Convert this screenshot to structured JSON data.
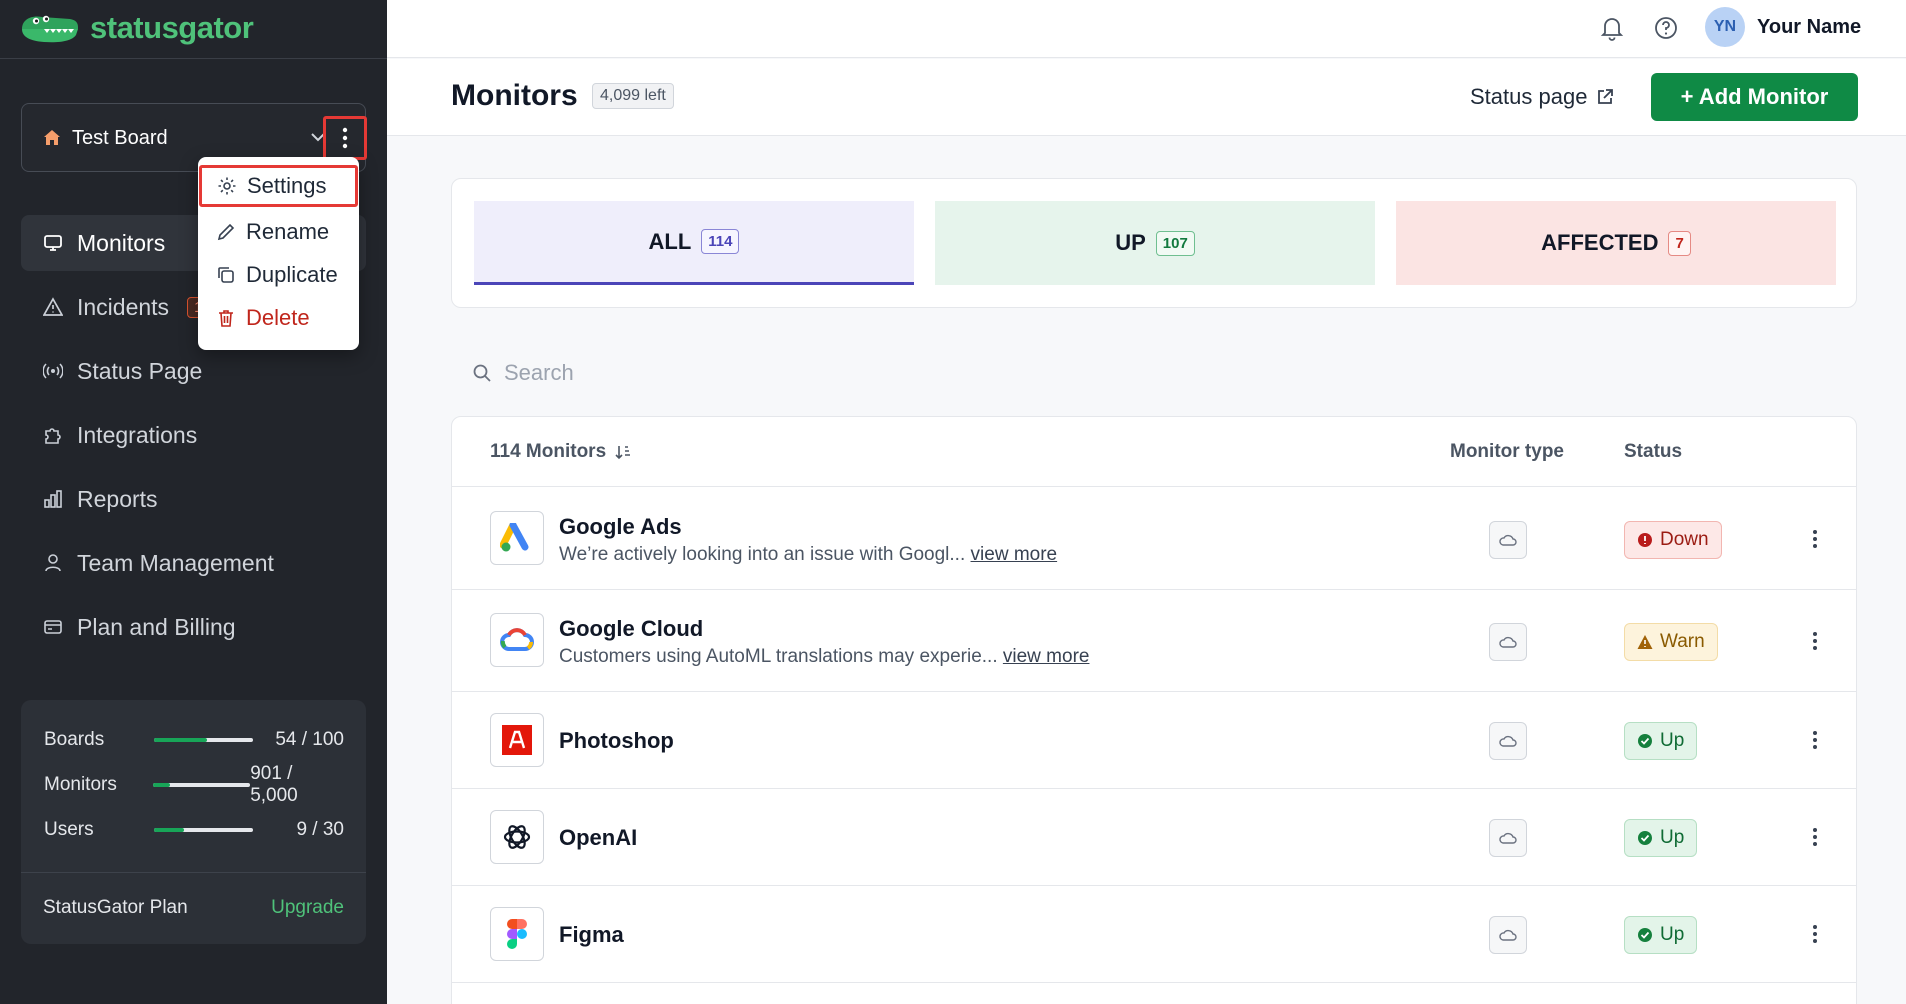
{
  "app": {
    "brand": "statusgator",
    "colors": {
      "sidebar": "#22252b",
      "accent_green": "#0f8a45",
      "brand_green": "#4fc27a",
      "highlight_red": "#e53935"
    }
  },
  "sidebar": {
    "board": {
      "name": "Test Board",
      "icon": "home-icon"
    },
    "board_menu": {
      "items": [
        {
          "label": "Settings",
          "icon": "gear-icon",
          "selected": true
        },
        {
          "label": "Rename",
          "icon": "pencil-icon"
        },
        {
          "label": "Duplicate",
          "icon": "copy-icon"
        },
        {
          "label": "Delete",
          "icon": "trash-icon",
          "danger": true
        }
      ]
    },
    "nav": [
      {
        "label": "Monitors",
        "icon": "monitor-icon",
        "active": true
      },
      {
        "label": "Incidents",
        "icon": "warning-icon",
        "badge": "1"
      },
      {
        "label": "Status Page",
        "icon": "broadcast-icon"
      },
      {
        "label": "Integrations",
        "icon": "puzzle-icon"
      },
      {
        "label": "Reports",
        "icon": "bar-chart-icon"
      },
      {
        "label": "Team Management",
        "icon": "user-icon"
      },
      {
        "label": "Plan and Billing",
        "icon": "credit-card-icon"
      }
    ],
    "usage": [
      {
        "label": "Boards",
        "value": "54 / 100",
        "fraction": 0.54
      },
      {
        "label": "Monitors",
        "value": "901 / 5,000",
        "fraction": 0.18
      },
      {
        "label": "Users",
        "value": "9 / 30",
        "fraction": 0.3
      }
    ],
    "plan": {
      "name": "StatusGator Plan",
      "upgrade_label": "Upgrade"
    }
  },
  "topbar": {
    "user_initials": "YN",
    "user_name": "Your Name",
    "icons": [
      "bell-icon",
      "help-icon"
    ]
  },
  "header": {
    "title": "Monitors",
    "left_badge": "4,099 left",
    "status_page_label": "Status page",
    "add_button_label": "+ Add Monitor"
  },
  "filters": [
    {
      "label": "ALL",
      "count": "114",
      "active": true
    },
    {
      "label": "UP",
      "count": "107"
    },
    {
      "label": "AFFECTED",
      "count": "7"
    }
  ],
  "search": {
    "placeholder": "Search"
  },
  "table": {
    "count_label": "114 Monitors",
    "col_type": "Monitor type",
    "col_status": "Status",
    "rows": [
      {
        "name": "Google Ads",
        "desc": "We’re actively looking into an issue with Googl...",
        "link": "view more",
        "status": "Down",
        "logo": "google-ads-logo-icon"
      },
      {
        "name": "Google Cloud",
        "desc": "Customers using AutoML translations may experie...",
        "link": "view more",
        "status": "Warn",
        "logo": "google-cloud-logo-icon"
      },
      {
        "name": "Photoshop",
        "status": "Up",
        "logo": "adobe-logo-icon"
      },
      {
        "name": "OpenAI",
        "status": "Up",
        "logo": "openai-logo-icon"
      },
      {
        "name": "Figma",
        "status": "Up",
        "logo": "figma-logo-icon"
      }
    ]
  }
}
